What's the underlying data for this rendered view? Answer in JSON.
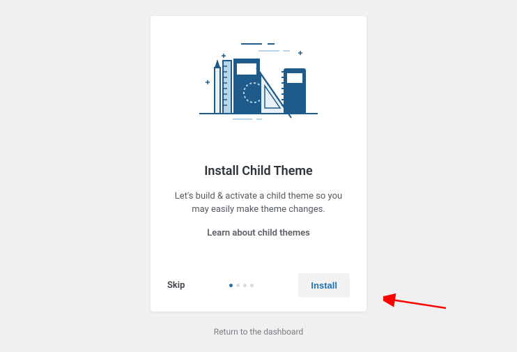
{
  "card": {
    "title": "Install Child Theme",
    "description": "Let's build & activate a child theme so you may easily make theme changes.",
    "learn_link": "Learn about child themes"
  },
  "footer": {
    "skip_label": "Skip",
    "install_label": "Install",
    "active_step": 0,
    "total_steps": 4
  },
  "return_link": "Return to the dashboard",
  "colors": {
    "accent": "#2271b1",
    "illustration_primary": "#1e5a8a",
    "illustration_light": "#b8d4e8"
  }
}
